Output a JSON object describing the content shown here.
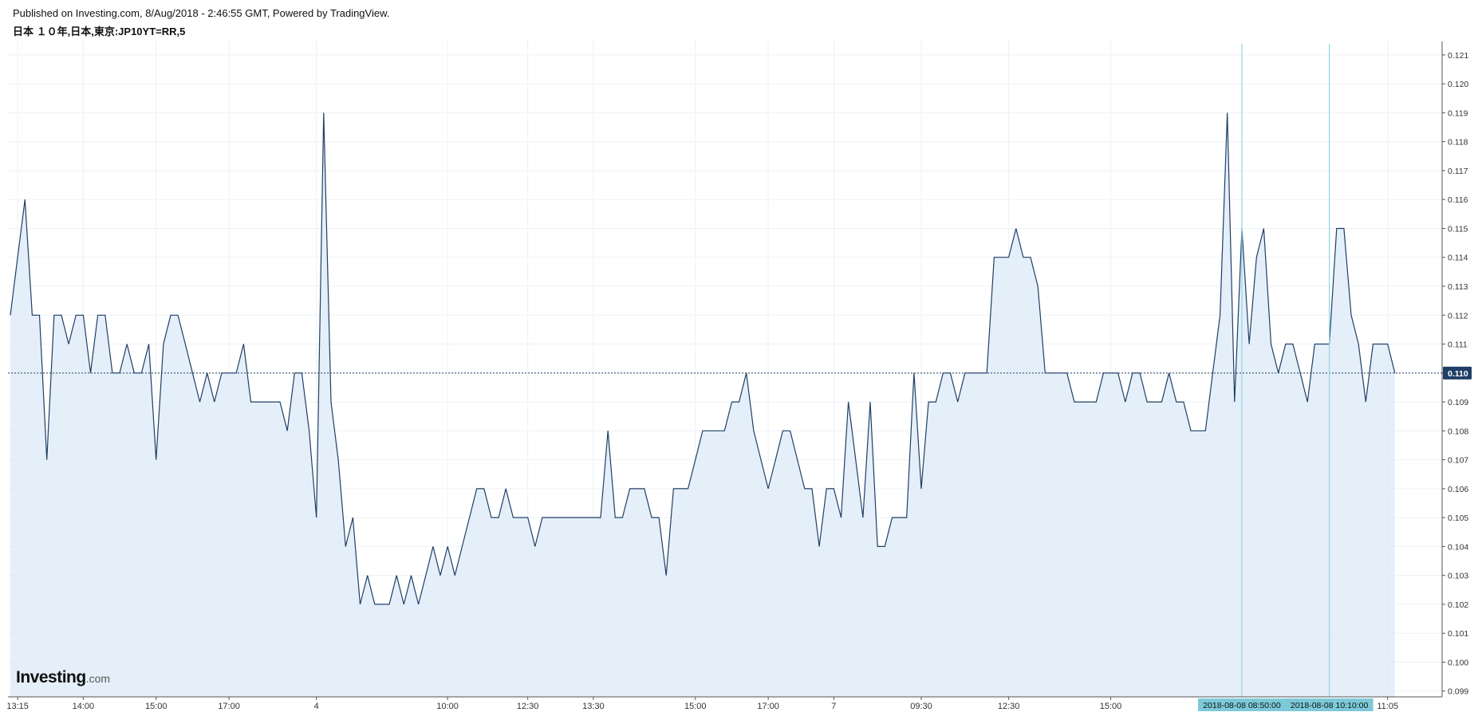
{
  "header": {
    "published": "Published on Investing.com, 8/Aug/2018 - 2:46:55 GMT, Powered by TradingView.",
    "instrument": "日本 １０年,日本,東京:JP10YT=RR,5"
  },
  "logo": {
    "brand": "Investing",
    "suffix": ".com"
  },
  "colors": {
    "line": "#1f3f66",
    "fill": "#dfebf8",
    "grid": "#eef1f5",
    "marker": "#8fd3e4",
    "marker_label_bg": "#7ccad8",
    "last_price_bg": "#1f3f66"
  },
  "chart_data": {
    "type": "area",
    "title": "日本 １０年,日本,東京:JP10YT=RR,5",
    "ylim": [
      0.0988,
      0.1213
    ],
    "yticks": [
      "0.121",
      "0.120",
      "0.119",
      "0.118",
      "0.117",
      "0.116",
      "0.115",
      "0.114",
      "0.113",
      "0.112",
      "0.111",
      "0.110",
      "0.109",
      "0.108",
      "0.107",
      "0.106",
      "0.105",
      "0.104",
      "0.103",
      "0.102",
      "0.101",
      "0.100",
      "0.099"
    ],
    "grid": true,
    "last_value": "0.110",
    "xticks": [
      {
        "label": "13:15",
        "i": 1
      },
      {
        "label": "14:00",
        "i": 10
      },
      {
        "label": "15:00",
        "i": 20
      },
      {
        "label": "17:00",
        "i": 30
      },
      {
        "label": "4",
        "i": 42
      },
      {
        "label": "10:00",
        "i": 60
      },
      {
        "label": "12:30",
        "i": 71
      },
      {
        "label": "13:30",
        "i": 80
      },
      {
        "label": "15:00",
        "i": 94
      },
      {
        "label": "17:00",
        "i": 104
      },
      {
        "label": "7",
        "i": 113
      },
      {
        "label": "09:30",
        "i": 125
      },
      {
        "label": "12:30",
        "i": 137
      },
      {
        "label": "15:00",
        "i": 151
      },
      {
        "label": "11:05",
        "i": 189
      }
    ],
    "markers": [
      {
        "label": "2018-08-08 08:50:00",
        "i": 169
      },
      {
        "label": "2018-08-08 10:10:00",
        "i": 181
      }
    ],
    "series": [
      {
        "values": [
          0.112,
          0.114,
          0.116,
          0.112,
          0.112,
          0.107,
          0.112,
          0.112,
          0.111,
          0.112,
          0.112,
          0.11,
          0.112,
          0.112,
          0.11,
          0.11,
          0.111,
          0.11,
          0.11,
          0.111,
          0.107,
          0.111,
          0.112,
          0.112,
          0.111,
          0.11,
          0.109,
          0.11,
          0.109,
          0.11,
          0.11,
          0.11,
          0.111,
          0.109,
          0.109,
          0.109,
          0.109,
          0.109,
          0.108,
          0.11,
          0.11,
          0.108,
          0.105,
          0.119,
          0.109,
          0.107,
          0.104,
          0.105,
          0.102,
          0.103,
          0.102,
          0.102,
          0.102,
          0.103,
          0.102,
          0.103,
          0.102,
          0.103,
          0.104,
          0.103,
          0.104,
          0.103,
          0.104,
          0.105,
          0.106,
          0.106,
          0.105,
          0.105,
          0.106,
          0.105,
          0.105,
          0.105,
          0.104,
          0.105,
          0.105,
          0.105,
          0.105,
          0.105,
          0.105,
          0.105,
          0.105,
          0.105,
          0.108,
          0.105,
          0.105,
          0.106,
          0.106,
          0.106,
          0.105,
          0.105,
          0.103,
          0.106,
          0.106,
          0.106,
          0.107,
          0.108,
          0.108,
          0.108,
          0.108,
          0.109,
          0.109,
          0.11,
          0.108,
          0.107,
          0.106,
          0.107,
          0.108,
          0.108,
          0.107,
          0.106,
          0.106,
          0.104,
          0.106,
          0.106,
          0.105,
          0.109,
          0.107,
          0.105,
          0.109,
          0.104,
          0.104,
          0.105,
          0.105,
          0.105,
          0.11,
          0.106,
          0.109,
          0.109,
          0.11,
          0.11,
          0.109,
          0.11,
          0.11,
          0.11,
          0.11,
          0.114,
          0.114,
          0.114,
          0.115,
          0.114,
          0.114,
          0.113,
          0.11,
          0.11,
          0.11,
          0.11,
          0.109,
          0.109,
          0.109,
          0.109,
          0.11,
          0.11,
          0.11,
          0.109,
          0.11,
          0.11,
          0.109,
          0.109,
          0.109,
          0.11,
          0.109,
          0.109,
          0.108,
          0.108,
          0.108,
          0.11,
          0.112,
          0.119,
          0.109,
          0.115,
          0.111,
          0.114,
          0.115,
          0.111,
          0.11,
          0.111,
          0.111,
          0.11,
          0.109,
          0.111,
          0.111,
          0.111,
          0.115,
          0.115,
          0.112,
          0.111,
          0.109,
          0.111,
          0.111,
          0.111,
          0.11
        ]
      }
    ]
  }
}
